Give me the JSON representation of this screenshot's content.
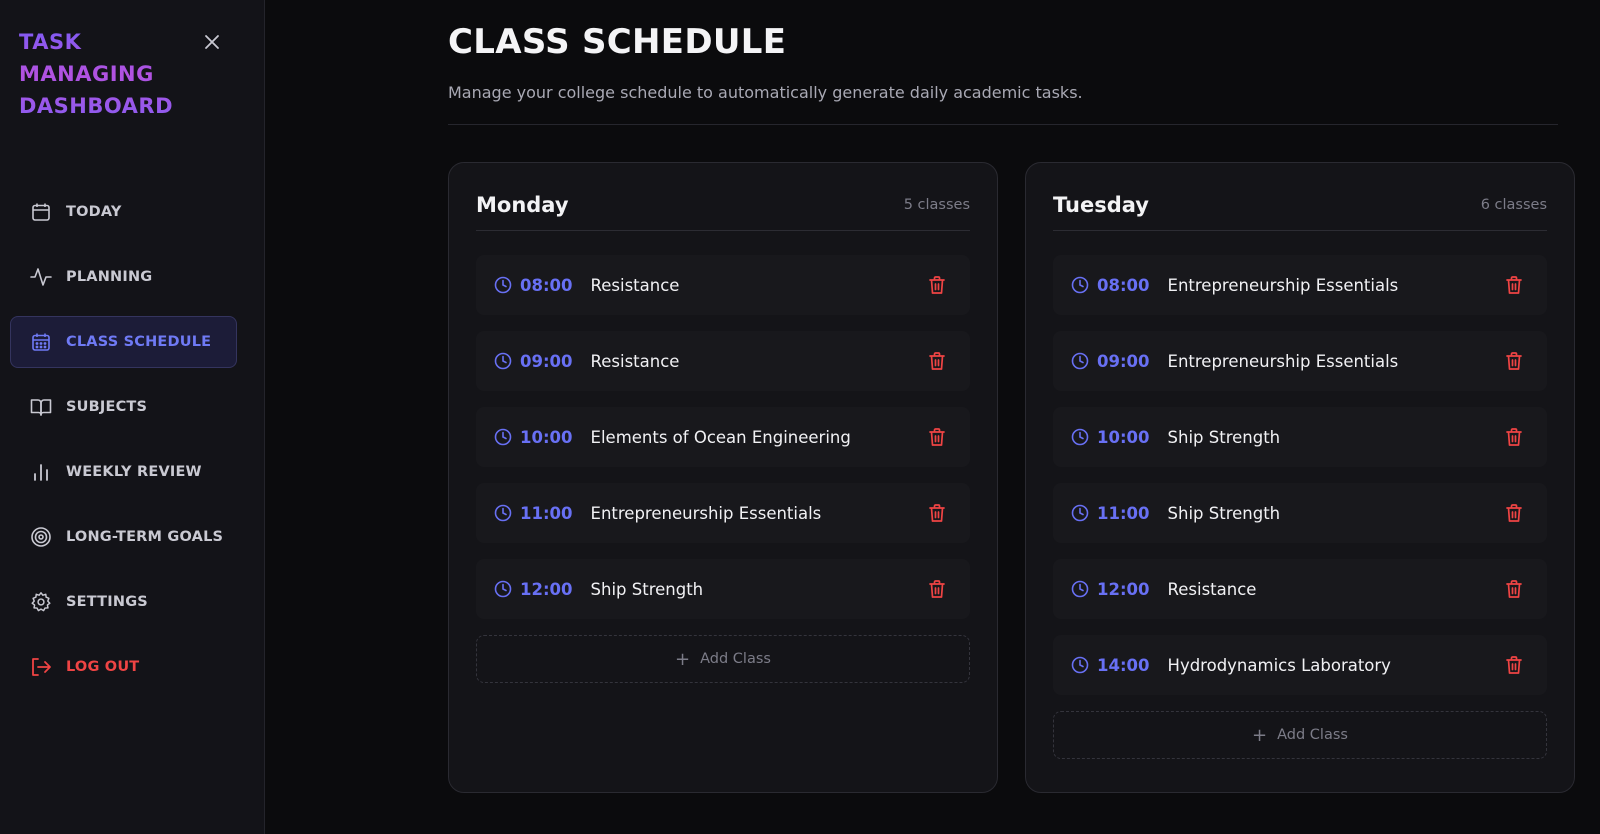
{
  "sidebar": {
    "brand_lines": [
      "TASK",
      "MANAGING",
      "DASHBOARD"
    ],
    "items": [
      {
        "label": "TODAY",
        "icon": "calendar-icon"
      },
      {
        "label": "PLANNING",
        "icon": "activity-icon"
      },
      {
        "label": "CLASS SCHEDULE",
        "icon": "calendar-grid-icon",
        "active": true
      },
      {
        "label": "SUBJECTS",
        "icon": "book-icon"
      },
      {
        "label": "WEEKLY REVIEW",
        "icon": "bar-chart-icon"
      },
      {
        "label": "LONG-TERM GOALS",
        "icon": "target-icon"
      },
      {
        "label": "SETTINGS",
        "icon": "gear-icon"
      }
    ],
    "logout_label": "LOG OUT"
  },
  "header": {
    "title": "CLASS SCHEDULE",
    "subtitle": "Manage your college schedule to automatically generate daily academic tasks."
  },
  "days": [
    {
      "name": "Monday",
      "count": "5 classes",
      "classes": [
        {
          "time": "08:00",
          "subject": "Resistance"
        },
        {
          "time": "09:00",
          "subject": "Resistance"
        },
        {
          "time": "10:00",
          "subject": "Elements of Ocean Engineering"
        },
        {
          "time": "11:00",
          "subject": "Entrepreneurship Essentials"
        },
        {
          "time": "12:00",
          "subject": "Ship Strength"
        }
      ],
      "add_label": "Add Class"
    },
    {
      "name": "Tuesday",
      "count": "6 classes",
      "classes": [
        {
          "time": "08:00",
          "subject": "Entrepreneurship Essentials"
        },
        {
          "time": "09:00",
          "subject": "Entrepreneurship Essentials"
        },
        {
          "time": "10:00",
          "subject": "Ship Strength"
        },
        {
          "time": "11:00",
          "subject": "Ship Strength"
        },
        {
          "time": "12:00",
          "subject": "Resistance"
        },
        {
          "time": "14:00",
          "subject": "Hydrodynamics Laboratory"
        }
      ],
      "add_label": "Add Class"
    }
  ],
  "colors": {
    "accent": "#6870f4",
    "danger": "#ef4444",
    "background": "#0b0b0d",
    "card": "#141418"
  }
}
